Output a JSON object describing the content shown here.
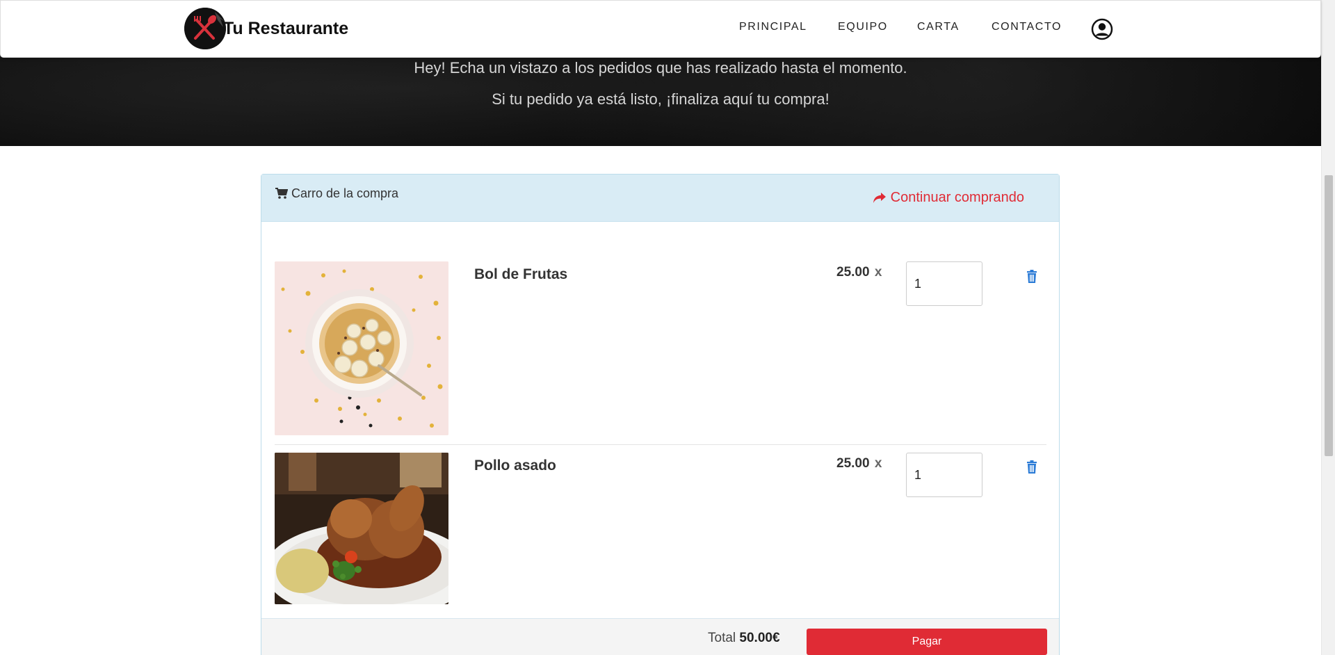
{
  "navbar": {
    "brand": "Tu Restaurante",
    "links": [
      "PRINCIPAL",
      "EQUIPO",
      "CARTA",
      "CONTACTO"
    ]
  },
  "hero": {
    "line1": "Hey! Echa un vistazo a los pedidos que has realizado hasta el momento.",
    "line2": "Si tu pedido ya está listo, ¡finaliza aquí tu compra!"
  },
  "cart": {
    "title": "Carro de la compra",
    "continue_label": "Continuar comprando",
    "items": [
      {
        "name": "Bol de Frutas",
        "price": "25.00",
        "times": "x",
        "quantity": "1"
      },
      {
        "name": "Pollo asado",
        "price": "25.00",
        "times": "x",
        "quantity": "1"
      }
    ],
    "total_label": "Total",
    "total_value": "50.00€",
    "pay_label": "Pagar"
  },
  "colors": {
    "accent": "#e02b35",
    "panel_header": "#d9ecf5",
    "trash_icon": "#2b7bd6"
  }
}
